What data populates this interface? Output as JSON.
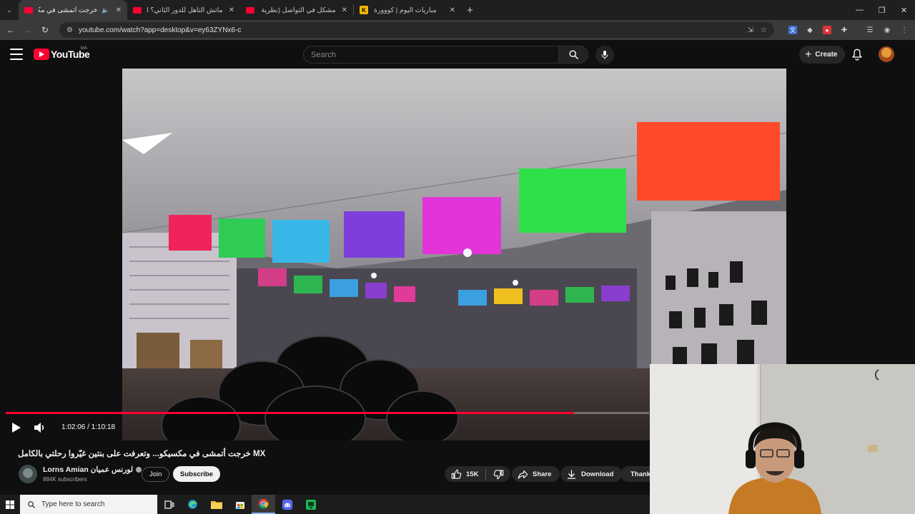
{
  "browser": {
    "tabs": [
      {
        "title": "خرجت أتمشى في مكسيكو...",
        "favicon": "youtube-favicon",
        "active": true
      },
      {
        "title": "ماتش التأهل للدور الثاني؟ التشك",
        "favicon": "youtube-favicon",
        "active": false
      },
      {
        "title": "مشكل في التواصل (نظرية البراك",
        "favicon": "youtube-favicon",
        "active": false
      },
      {
        "title": "مباريات اليوم | كووورة",
        "favicon": "kooora-favicon",
        "active": false
      }
    ],
    "kooora_favicon_letter": "K",
    "url": "youtube.com/watch?app=desktop&v=ey63ZYNx6-c"
  },
  "youtube": {
    "logo_text": "YouTube",
    "country_code": "MA",
    "search_placeholder": "Search",
    "create_label": "Create"
  },
  "player": {
    "current_time": "1:02:06",
    "duration": "1:10:18",
    "progress_fraction": 0.8834
  },
  "video": {
    "title": "خرجت أتمشى في مكسيكو... وتعرفت على بنتين غيّروا رحلتي بالكامل MX",
    "channel_name": "Lorns Amian لورنس عميان",
    "subscribers": "884K subscribers",
    "join_label": "Join",
    "subscribe_label": "Subscribe",
    "likes": "15K",
    "share_label": "Share",
    "download_label": "Download",
    "thanks_label": "Thanks"
  },
  "taskbar": {
    "search_placeholder": "Type here to search"
  },
  "colors": {
    "youtube_red": "#ff0033",
    "page_background": "#0f0f0f",
    "taskbar_background": "#1c1c1c"
  }
}
